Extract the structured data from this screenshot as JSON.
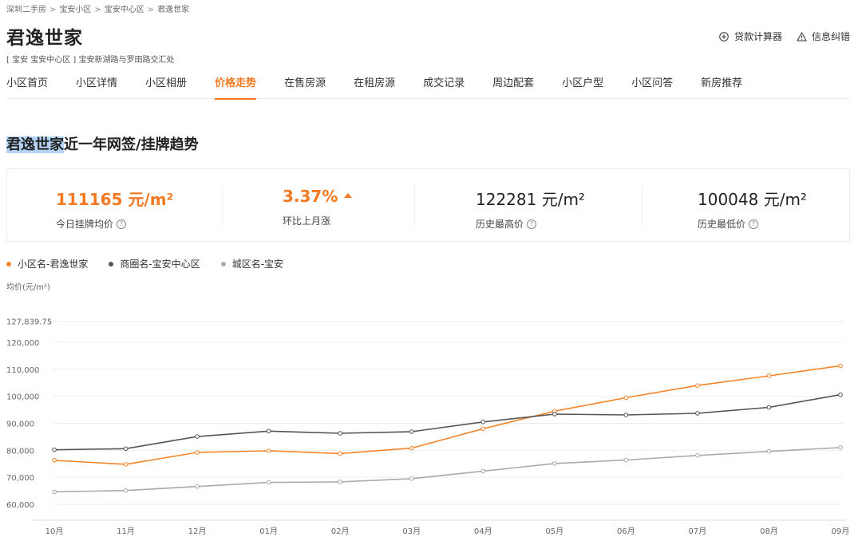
{
  "breadcrumb": [
    "深圳二手房",
    "宝安小区",
    "宝安中心区",
    "君逸世家"
  ],
  "title": "君逸世家",
  "address": "[ 宝安 宝安中心区 ] 宝安新湖路与罗田路交汇处",
  "tools": {
    "calculator": "贷款计算器",
    "correction": "信息纠错"
  },
  "tabs": [
    "小区首页",
    "小区详情",
    "小区相册",
    "价格走势",
    "在售房源",
    "在租房源",
    "成交记录",
    "周边配套",
    "小区户型",
    "小区问答",
    "新房推荐"
  ],
  "active_tab": "价格走势",
  "section": {
    "highlight": "君逸世家",
    "rest": "近一年网签/挂牌趋势"
  },
  "stats": {
    "listing_avg": {
      "value": "111165 元/m²",
      "label": "今日挂牌均价"
    },
    "mom": {
      "value": "3.37%",
      "label": "环比上月涨"
    },
    "hist_high": {
      "value": "122281 元/m²",
      "label": "历史最高价"
    },
    "hist_low": {
      "value": "100048 元/m²",
      "label": "历史最低价"
    }
  },
  "colors": {
    "accent": "#f47920",
    "series_community": "#f5852a",
    "series_business": "#555555",
    "series_district": "#aaaaaa"
  },
  "chart_data": {
    "type": "line",
    "ylabel": "均价(元/m²)",
    "categories": [
      "10月",
      "11月",
      "12月",
      "01月",
      "02月",
      "03月",
      "04月",
      "05月",
      "06月",
      "07月",
      "08月",
      "09月"
    ],
    "yticks": [
      "127,839.75",
      "120,000",
      "110,000",
      "100,000",
      "90,000",
      "80,000",
      "70,000",
      "60,000"
    ],
    "ylim": [
      60000,
      127839.75
    ],
    "grid": true,
    "legend_position": "top-left",
    "series": [
      {
        "name": "小区名-君逸世家",
        "color": "#f5852a",
        "values": [
          76300,
          74800,
          79200,
          79800,
          78800,
          80800,
          88000,
          94500,
          99500,
          104000,
          107600,
          111300
        ]
      },
      {
        "name": "商圈名-宝安中心区",
        "color": "#555555",
        "values": [
          80200,
          80600,
          85100,
          87100,
          86300,
          86900,
          90500,
          93400,
          93100,
          93700,
          95900,
          100600
        ]
      },
      {
        "name": "城区名-宝安",
        "color": "#aaaaaa",
        "values": [
          64600,
          65100,
          66600,
          68100,
          68300,
          69500,
          72300,
          75100,
          76400,
          78100,
          79600,
          81000
        ]
      }
    ]
  }
}
